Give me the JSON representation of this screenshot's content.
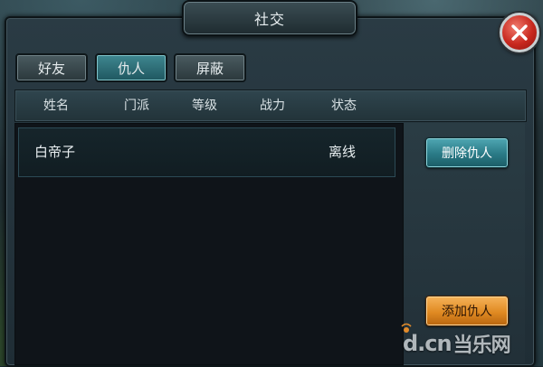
{
  "dialog": {
    "title": "社交"
  },
  "tabs": [
    {
      "label": "好友",
      "active": false
    },
    {
      "label": "仇人",
      "active": true
    },
    {
      "label": "屏蔽",
      "active": false
    }
  ],
  "table": {
    "columns": [
      "姓名",
      "门派",
      "等级",
      "战力",
      "状态"
    ],
    "rows": [
      {
        "name": "白帝子",
        "sect": "",
        "level": "",
        "power": "",
        "status": "离线"
      }
    ]
  },
  "actions": {
    "delete_label": "删除仇人",
    "add_label": "添加仇人"
  },
  "watermark": {
    "brand": "d.cn",
    "brand_cn": "当乐网"
  },
  "colors": {
    "active_tab": "#2f7680",
    "delete_button": "#2a7a86",
    "add_button": "#e08a22",
    "close_button": "#c8281e"
  },
  "icons": {
    "close": "close-x-icon",
    "watermark": "signal-dot-icon"
  }
}
